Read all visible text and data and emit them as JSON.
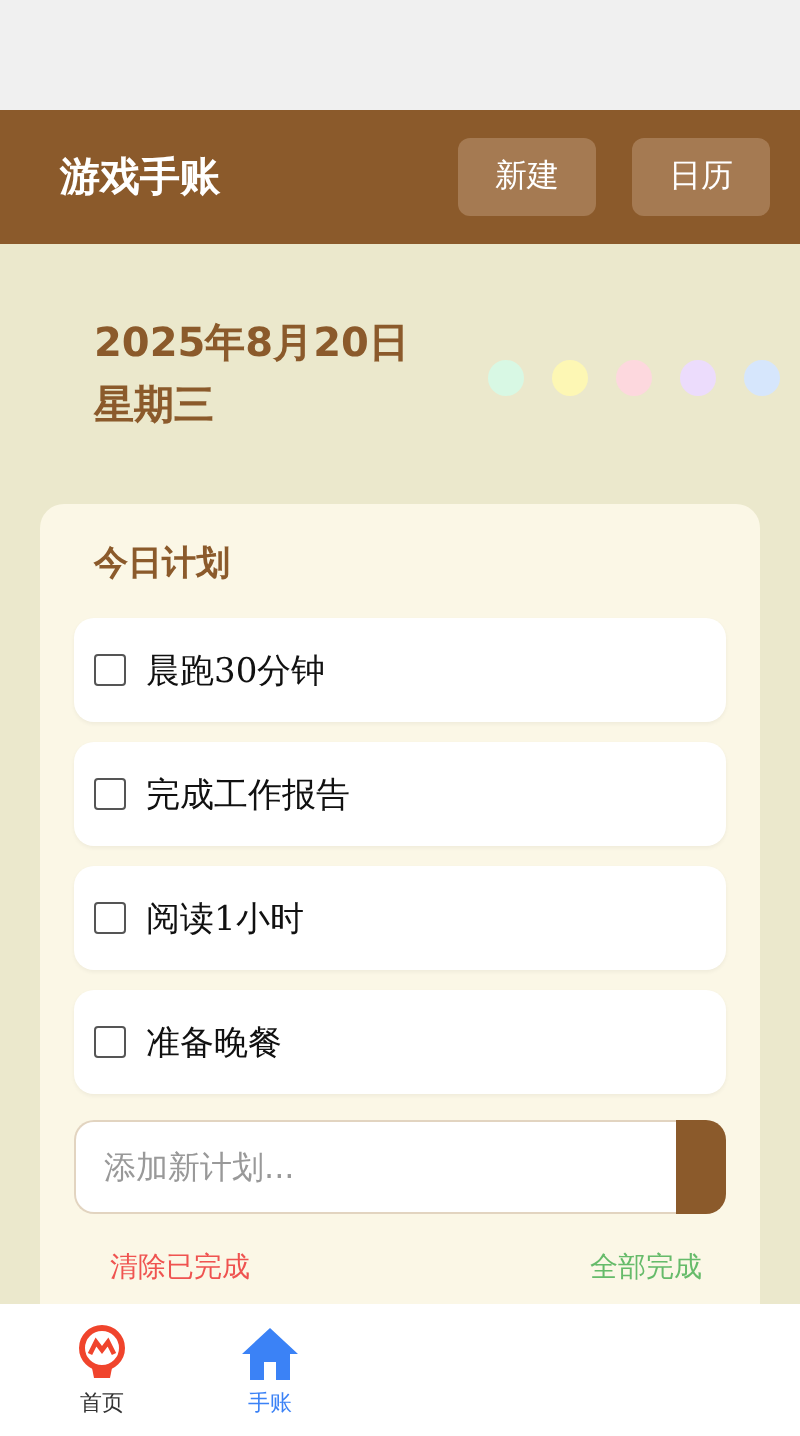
{
  "header": {
    "title": "游戏手账",
    "buttons": [
      "新建",
      "日历"
    ]
  },
  "date": {
    "day": "2025年8月20日",
    "weekday": "星期三"
  },
  "color_dots": [
    {
      "color": "#d8f8e4"
    },
    {
      "color": "#fdf7b4"
    },
    {
      "color": "#fdd8de"
    },
    {
      "color": "#ecdcfc"
    },
    {
      "color": "#d6e6fc"
    }
  ],
  "plan": {
    "title": "今日计划",
    "tasks": [
      {
        "text": "晨跑30分钟",
        "checked": false
      },
      {
        "text": "完成工作报告",
        "checked": false
      },
      {
        "text": "阅读1小时",
        "checked": false
      },
      {
        "text": "准备晚餐",
        "checked": false
      }
    ],
    "input": {
      "placeholder": "添加新计划..."
    },
    "actions": [
      {
        "label": "清除已完成",
        "kind": "clear"
      },
      {
        "label": "全部完成",
        "kind": "complete"
      }
    ]
  },
  "tab_bar": [
    {
      "label": "首页",
      "kind": "home",
      "selected": false
    },
    {
      "label": "手账",
      "kind": "journal",
      "selected": true
    }
  ]
}
